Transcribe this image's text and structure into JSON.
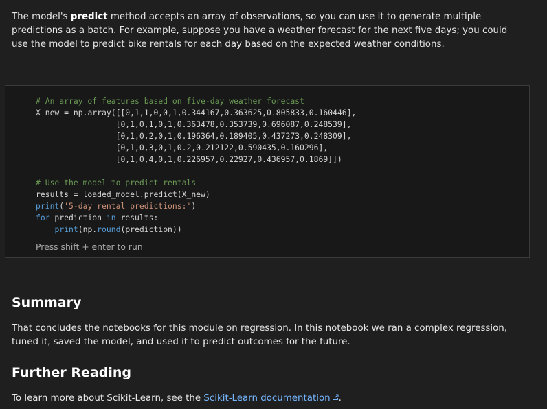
{
  "intro": {
    "prefix": "The model's ",
    "bold": "predict",
    "rest": " method accepts an array of observations, so you can use it to generate multiple predictions as a batch. For example, suppose you have a weather forecast for the next five days; you could use the model to predict bike rentals for each day based on the expected weather conditions."
  },
  "code_cell": {
    "comment1": "# An array of features based on five-day weather forecast",
    "line1_var": "X_new = np.",
    "line1_fn": "array",
    "line1_rest": "([[0,1,1,0,0,1,0.344167,0.363625,0.805833,0.160446],",
    "row2": "                 [0,1,0,1,0,1,0.363478,0.353739,0.696087,0.248539],",
    "row3": "                 [0,1,0,2,0,1,0.196364,0.189405,0.437273,0.248309],",
    "row4": "                 [0,1,0,3,0,1,0.2,0.212122,0.590435,0.160296],",
    "row5": "                 [0,1,0,4,0,1,0.226957,0.22927,0.436957,0.1869]])",
    "comment2": "# Use the model to predict rentals",
    "results_pre": "results = loaded_model.",
    "results_fn": "predict",
    "results_post": "(X_new)",
    "print_fn": "print",
    "print_open": "(",
    "print_str": "'5-day rental predictions:'",
    "print_close": ")",
    "for_kw": "for",
    "for_var": " prediction ",
    "in_kw": "in",
    "for_rest": " results:",
    "indent": "    ",
    "print2_fn": "print",
    "print2_mid": "(np.",
    "round_fn": "round",
    "print2_end": "(prediction))",
    "hint": "Press shift + enter to run"
  },
  "summary": {
    "heading": "Summary",
    "text": "That concludes the notebooks for this module on regression. In this notebook we ran a complex regression, tuned it, saved the model, and used it to predict outcomes for the future."
  },
  "further": {
    "heading": "Further Reading",
    "prefix": "To learn more about Scikit-Learn, see the ",
    "link_text": "Scikit-Learn documentation",
    "suffix": "."
  },
  "icons": {
    "external_link": "external-link-icon"
  },
  "colors": {
    "background": "#1f1f1f",
    "link": "#75b6ff",
    "comment": "#6a9955",
    "keyword": "#569cd6",
    "string": "#ce9178",
    "function": "#dcdcaa"
  }
}
